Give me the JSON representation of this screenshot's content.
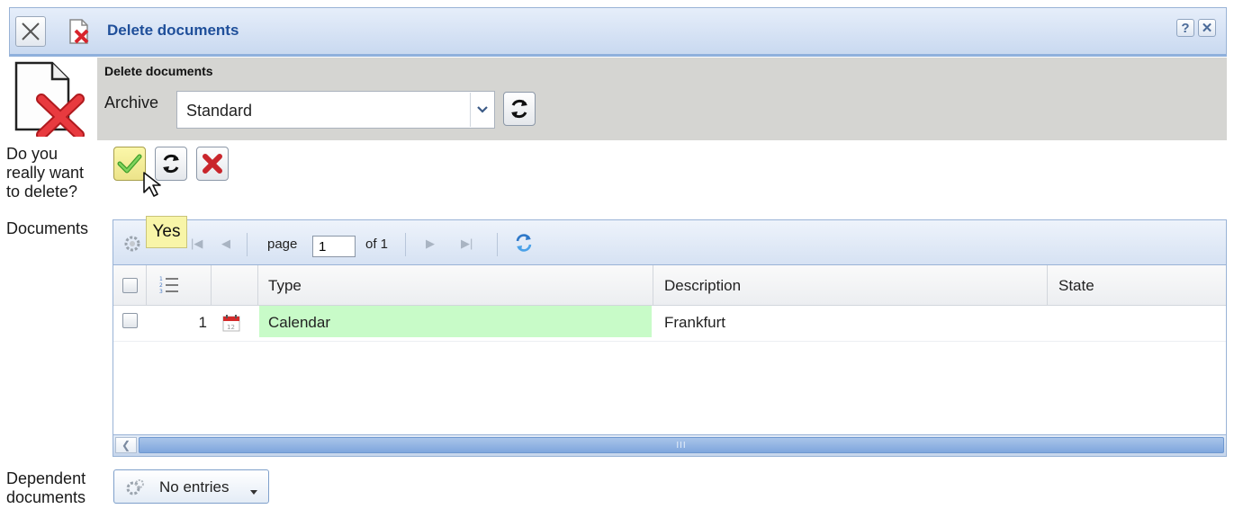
{
  "window": {
    "title": "Delete documents",
    "help_label": "?",
    "close_label": "✕"
  },
  "header": {
    "section_title": "Delete documents",
    "archive_label": "Archive",
    "archive_value": "Standard"
  },
  "confirm": {
    "question_lines": [
      "Do you",
      "really want",
      "to delete?"
    ],
    "tooltip": "Yes"
  },
  "documents": {
    "label": "Documents",
    "pager": {
      "page_label": "page",
      "page_value": "1",
      "of_label": "of 1"
    },
    "columns": [
      "Type",
      "Description",
      "State"
    ],
    "rows": [
      {
        "number": "1",
        "type": "Calendar",
        "description": "Frankfurt",
        "state": ""
      }
    ],
    "scroll_grip": "III"
  },
  "dependent": {
    "label_lines": [
      "Dependent",
      "documents"
    ],
    "button_label": "No entries"
  },
  "colors": {
    "title_text": "#1f4f9a",
    "band": "#d5d5d2",
    "highlight_cell": "#c8fbc8",
    "tooltip": "#f8f5a8"
  }
}
